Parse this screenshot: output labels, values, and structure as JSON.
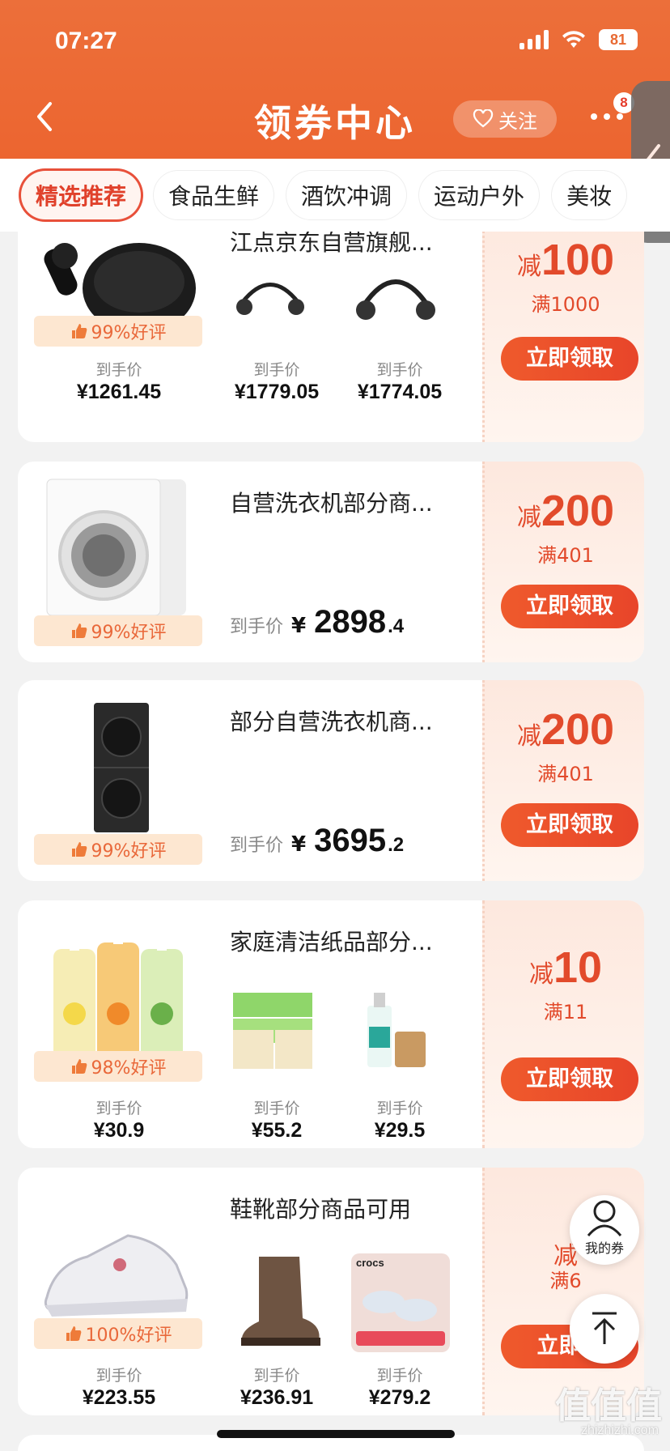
{
  "status": {
    "time": "07:27",
    "battery": "81"
  },
  "header": {
    "title": "领券中心",
    "follow_label": "关注",
    "more_badge": "8"
  },
  "tabs": [
    "精选推荐",
    "食品生鲜",
    "酒饮冲调",
    "运动户外",
    "美妆"
  ],
  "cards": [
    {
      "title": "江点京东自营旗舰...",
      "rating": "99%好评",
      "products": [
        {
          "label": "到手价",
          "price": "¥1261.45"
        },
        {
          "label": "到手价",
          "price": "¥1779.05"
        },
        {
          "label": "到手价",
          "price": "¥1774.05"
        }
      ],
      "coupon": {
        "prefix": "减",
        "amount": "100",
        "condition": "满1000",
        "button": "立即领取"
      }
    },
    {
      "title": "自营洗衣机部分商...",
      "rating": "99%好评",
      "price_label": "到手价",
      "price_currency": "¥",
      "price_int": "2898",
      "price_dec": ".4",
      "coupon": {
        "prefix": "减",
        "amount": "200",
        "condition": "满401",
        "button": "立即领取"
      }
    },
    {
      "title": "部分自营洗衣机商...",
      "rating": "99%好评",
      "price_label": "到手价",
      "price_currency": "¥",
      "price_int": "3695",
      "price_dec": ".2",
      "coupon": {
        "prefix": "减",
        "amount": "200",
        "condition": "满401",
        "button": "立即领取"
      }
    },
    {
      "title": "家庭清洁纸品部分...",
      "rating": "98%好评",
      "products": [
        {
          "label": "到手价",
          "price": "¥30.9"
        },
        {
          "label": "到手价",
          "price": "¥55.2"
        },
        {
          "label": "到手价",
          "price": "¥29.5"
        }
      ],
      "coupon": {
        "prefix": "减",
        "amount": "10",
        "condition": "满11",
        "button": "立即领取"
      }
    },
    {
      "title": "鞋靴部分商品可用",
      "rating": "100%好评",
      "products": [
        {
          "label": "到手价",
          "price": "¥223.55"
        },
        {
          "label": "到手价",
          "price": "¥236.91"
        },
        {
          "label": "到手价",
          "price": "¥279.2"
        }
      ],
      "coupon": {
        "prefix": "减",
        "amount": "",
        "condition": "满6",
        "button": "立即领"
      }
    }
  ],
  "floating": {
    "my_coupons": "我的券"
  },
  "watermark": {
    "main": "值值值",
    "sub": "zhizhizhi.com"
  },
  "colors": {
    "brand": "#ec6a34",
    "accent": "#e24a2b"
  }
}
